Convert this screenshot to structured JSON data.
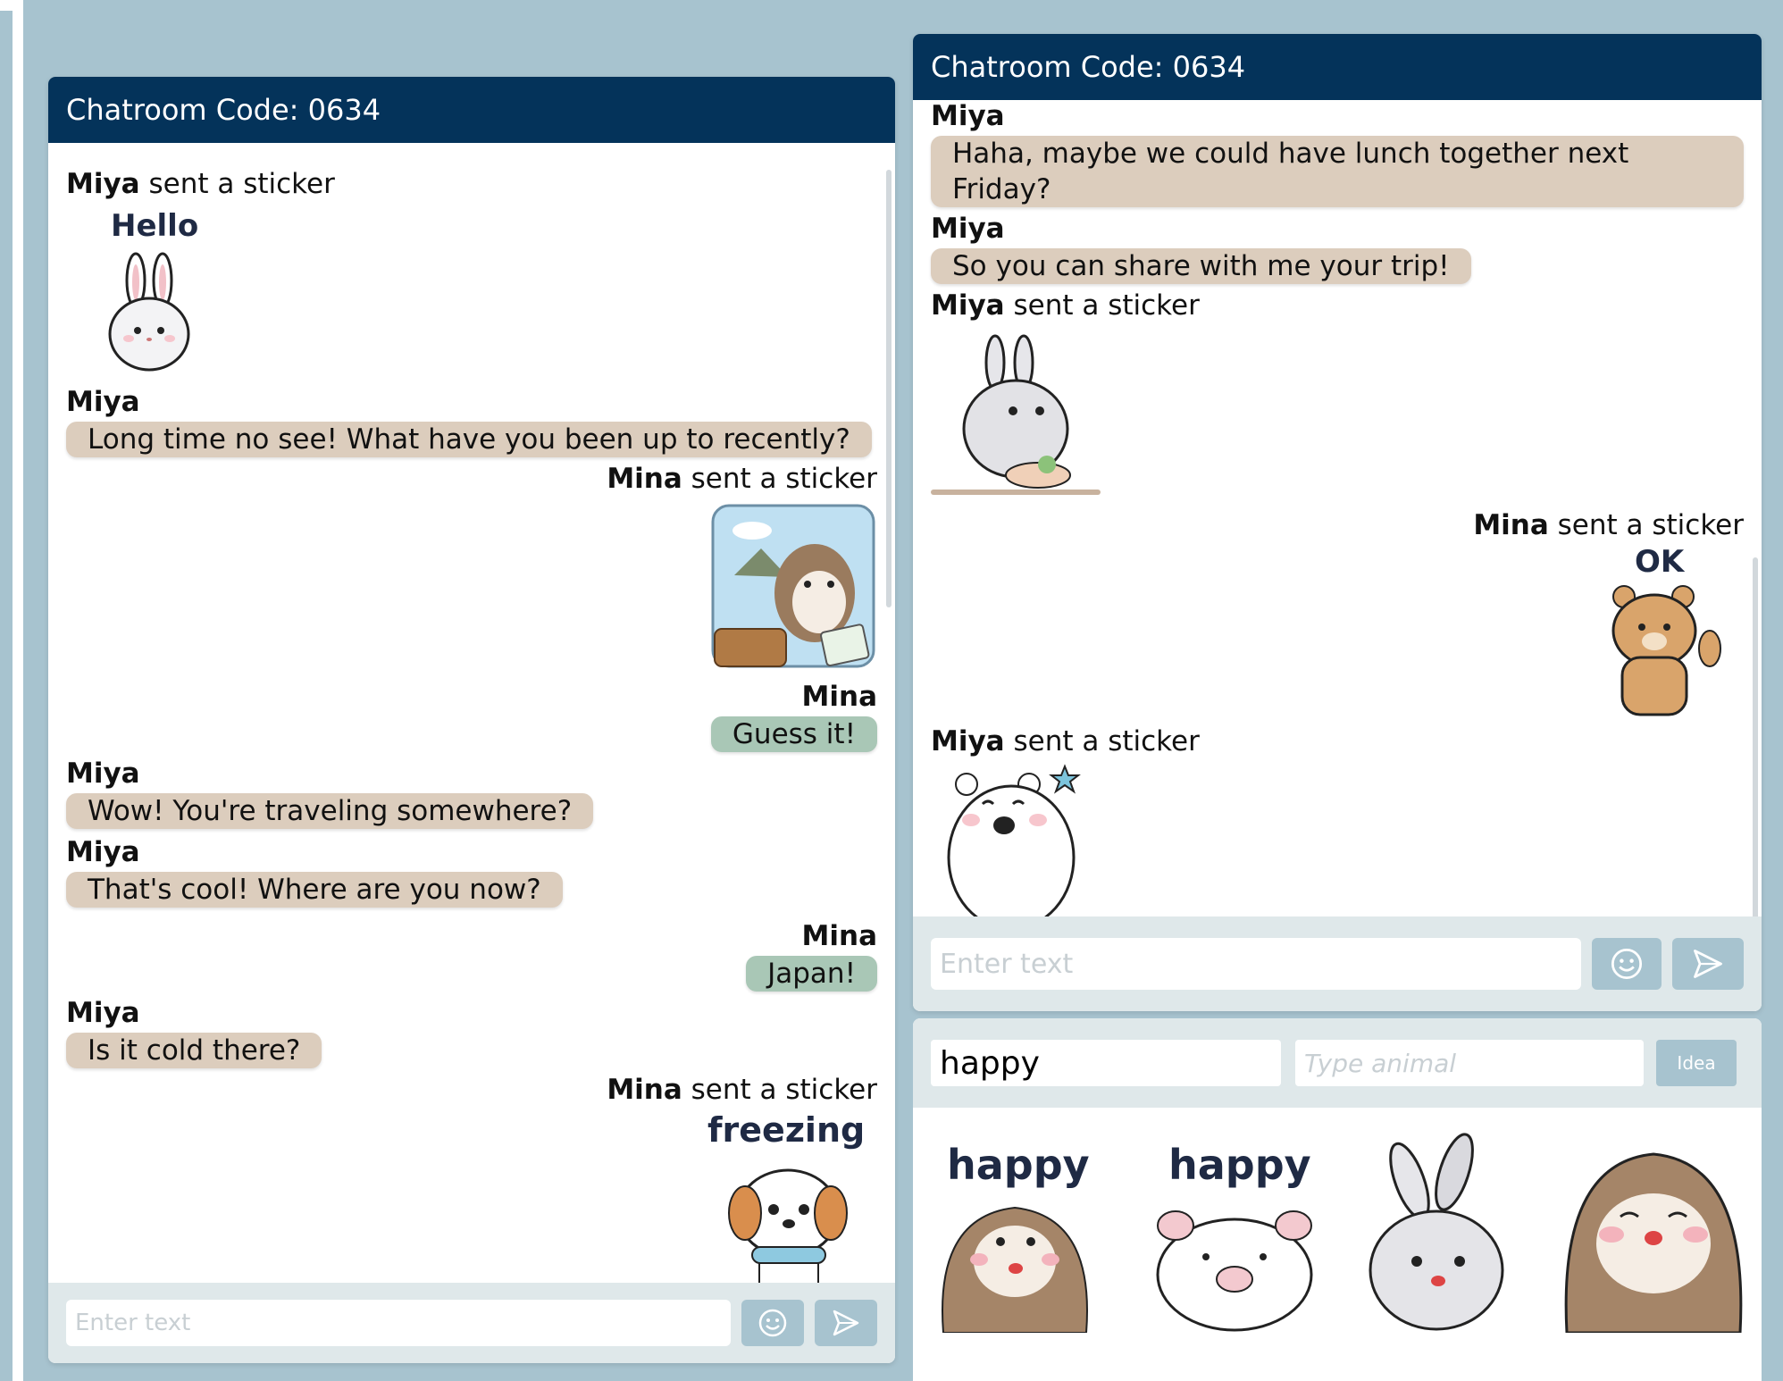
{
  "left_chat": {
    "header": "Chatroom Code: 0634",
    "messages": [
      {
        "sender": "Miya",
        "note": "sent a sticker",
        "sticker": "bunny-hello-sticker",
        "sticker_text": "Hello"
      },
      {
        "sender": "Miya",
        "text": "Long time no see! What have you been up to recently?"
      },
      {
        "sender": "Mina",
        "note": "sent a sticker",
        "sticker": "otter-travel-sticker"
      },
      {
        "sender": "Mina",
        "text": "Guess it!"
      },
      {
        "sender": "Miya",
        "text": "Wow! You're traveling somewhere?"
      },
      {
        "sender": "Miya",
        "text": "That's cool! Where are you now?"
      },
      {
        "sender": "Mina",
        "text": "Japan!"
      },
      {
        "sender": "Miya",
        "text": "Is it cold there?"
      },
      {
        "sender": "Mina",
        "note": "sent a sticker",
        "sticker": "puppy-freezing-sticker",
        "sticker_text": "freezing"
      }
    ],
    "input_placeholder": "Enter text"
  },
  "right_chat": {
    "header": "Chatroom Code: 0634",
    "messages": [
      {
        "sender": "Miya",
        "text": "Haha, maybe we could have lunch together next Friday?"
      },
      {
        "sender": "Miya",
        "text": "So you can share with me your trip!"
      },
      {
        "sender": "Miya",
        "note": "sent a sticker",
        "sticker": "bunny-eating-sticker"
      },
      {
        "sender": "Mina",
        "note": "sent a sticker",
        "sticker": "bear-ok-sticker",
        "sticker_text": "OK"
      },
      {
        "sender": "Miya",
        "note": "sent a sticker",
        "sticker": "polar-bear-wave-sticker"
      }
    ],
    "input_placeholder": "Enter text"
  },
  "sticker_search": {
    "keyword_value": "happy",
    "animal_placeholder": "Type animal",
    "idea_label": "Idea",
    "results": [
      {
        "icon": "otter-happy-sticker",
        "caption": "happy"
      },
      {
        "icon": "pig-happy-sticker",
        "caption": "happy"
      },
      {
        "icon": "bunny-happy-sticker",
        "caption": ""
      },
      {
        "icon": "otter-smile-sticker",
        "caption": ""
      }
    ]
  },
  "icons": {
    "emoji_button": "smiley-icon",
    "send_button": "send-icon"
  },
  "colors": {
    "header": "#04335a",
    "background": "#a7c3cf",
    "miya_bubble": "#dccdbd",
    "mina_bubble": "#a9c7b6",
    "input_bar": "#dfe8ea"
  }
}
